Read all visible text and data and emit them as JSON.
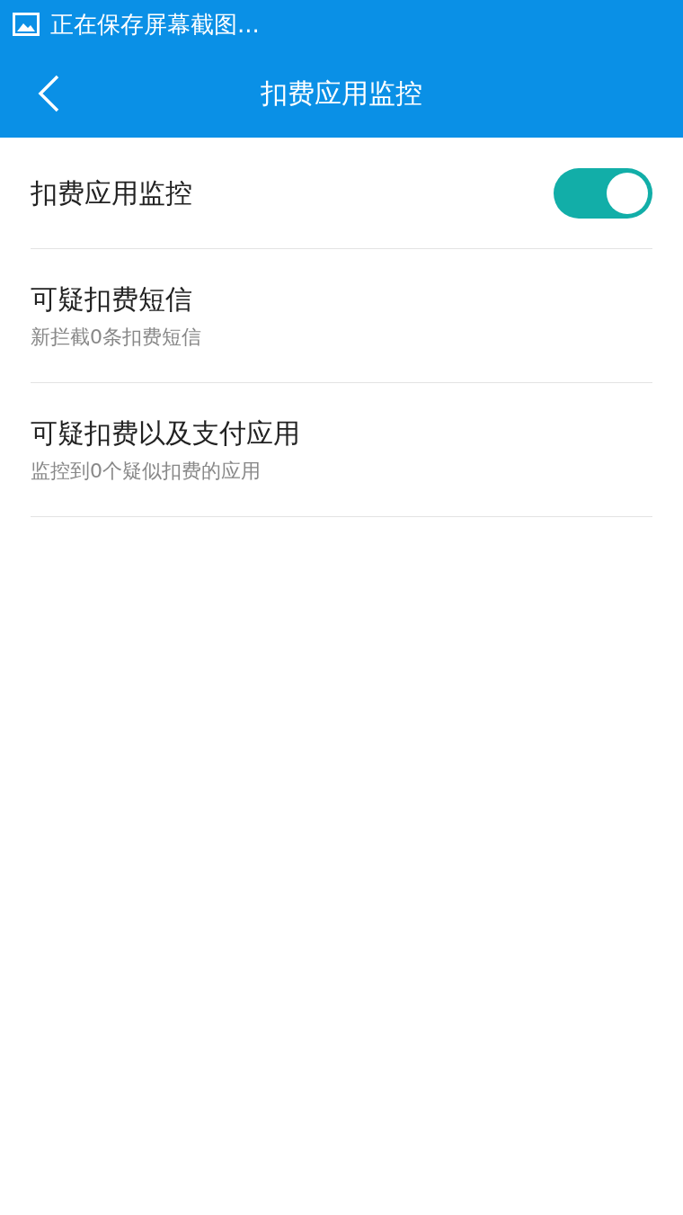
{
  "status_bar": {
    "notification": "正在保存屏幕截图..."
  },
  "header": {
    "title": "扣费应用监控"
  },
  "settings": [
    {
      "kind": "toggle",
      "title": "扣费应用监控",
      "on": true
    },
    {
      "kind": "info",
      "title": "可疑扣费短信",
      "subtitle": "新拦截0条扣费短信"
    },
    {
      "kind": "info",
      "title": "可疑扣费以及支付应用",
      "subtitle": "监控到0个疑似扣费的应用"
    }
  ]
}
